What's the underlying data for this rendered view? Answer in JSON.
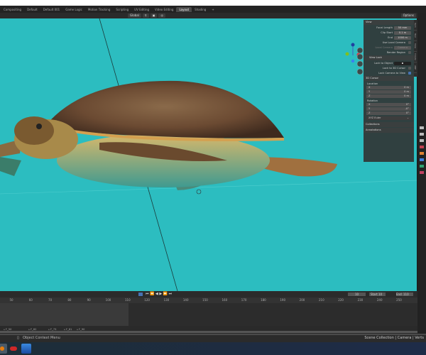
{
  "workspace_tabs": [
    "Compositing",
    "Default",
    "Default 001",
    "Game Logic",
    "Motion Tracking",
    "Scripting",
    "UV Editing",
    "Video Editing",
    "Layout",
    "Shading"
  ],
  "active_tab": "Layout",
  "add_tab": "+",
  "viewport_header": {
    "orientation": "Global",
    "options": "Options"
  },
  "npanel": {
    "view_title": "View",
    "focal_length_label": "Focal Length",
    "focal_length": "50 mm",
    "clip_start_label": "Clip Start",
    "clip_start": "0.1 m",
    "end_label": "End",
    "clip_end": "1000 m",
    "use_local_camera": "Use Local Camera",
    "local_camera_label": "Local Camera",
    "local_camera": "Camera",
    "render_region": "Render Region",
    "view_lock_title": "View Lock",
    "lock_to_object": "Lock to Object",
    "lock_to_3d_cursor": "Lock to 3D Cursor",
    "lock_camera_to_view": "Lock Camera to View",
    "cursor_title": "3D Cursor",
    "location_label": "Location",
    "location": [
      {
        "axis": "X",
        "value": "0 m"
      },
      {
        "axis": "Y",
        "value": "0 m"
      },
      {
        "axis": "Z",
        "value": "0 m"
      }
    ],
    "rotation_label": "Rotation",
    "rotation": [
      {
        "axis": "X",
        "value": "0°"
      },
      {
        "axis": "Y",
        "value": "-0°"
      },
      {
        "axis": "Z",
        "value": "0°"
      }
    ],
    "rotation_mode": "XYZ Euler",
    "collections": "Collections",
    "annotations": "Annotations",
    "side_tabs": [
      "Item",
      "Tool",
      "View",
      "Create",
      "ARP"
    ]
  },
  "timeline": {
    "current_frame": "10",
    "start_label": "Start",
    "start": "10",
    "end_label": "End",
    "end": "110",
    "ruler": [
      "50",
      "60",
      "70",
      "80",
      "90",
      "100",
      "110",
      "120",
      "130",
      "140",
      "150",
      "160",
      "170",
      "180",
      "190",
      "200",
      "210",
      "220",
      "230",
      "240",
      "250"
    ],
    "markers": [
      "F_50",
      "F_62",
      "F_73",
      "F_81",
      "F_90"
    ]
  },
  "status": {
    "left": "Object Context Menu",
    "right": "Scene Collection | Camera | Verts"
  }
}
